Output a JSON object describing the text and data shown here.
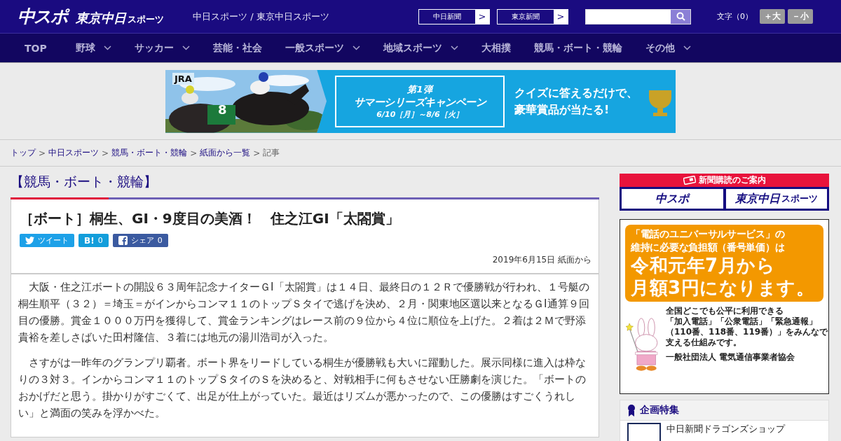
{
  "header": {
    "logo": {
      "main": "中スポ",
      "sub": "東京中日",
      "sub_small": "スポーツ"
    },
    "site_title": "中日スポーツ / 東京中日スポーツ",
    "paper_links": [
      {
        "label": "中日新聞",
        "arrow": ">"
      },
      {
        "label": "東京新聞",
        "arrow": ">"
      }
    ],
    "font_size": {
      "label": "文字（0）",
      "buttons": [
        "＋大",
        "－小"
      ]
    }
  },
  "nav": [
    {
      "label": "TOP",
      "dropdown": false
    },
    {
      "label": "野球",
      "dropdown": true
    },
    {
      "label": "サッカー",
      "dropdown": true
    },
    {
      "label": "芸能・社会",
      "dropdown": false
    },
    {
      "label": "一般スポーツ",
      "dropdown": true
    },
    {
      "label": "地域スポーツ",
      "dropdown": true
    },
    {
      "label": "大相撲",
      "dropdown": false
    },
    {
      "label": "競馬・ボート・競輪",
      "dropdown": false
    },
    {
      "label": "その他",
      "dropdown": true
    }
  ],
  "banner": {
    "brand": "JRA",
    "saddle_number": "8",
    "round": "第1弾",
    "campaign": "サマーシリーズキャンペーン",
    "period": "6/10［月］～8/6［火］",
    "copy": [
      "クイズに答えるだけで、",
      "豪華賞品が当たる!"
    ]
  },
  "breadcrumb": {
    "separator": ">",
    "items": [
      {
        "label": "トップ",
        "link": true
      },
      {
        "label": "中日スポーツ",
        "link": true
      },
      {
        "label": "競馬・ボート・競輪",
        "link": true
      },
      {
        "label": "紙面から一覧",
        "link": true
      },
      {
        "label": "記事",
        "link": false
      }
    ]
  },
  "category": "【競馬・ボート・競輪】",
  "article": {
    "title": "［ボート］桐生、GI・9度目の美酒！　住之江GI「太閤賞」",
    "share": [
      {
        "kind": "twitter",
        "label": "ツイート"
      },
      {
        "kind": "hatena",
        "label": "B!",
        "count": "0"
      },
      {
        "kind": "facebook",
        "label": "シェア",
        "count": "0"
      }
    ],
    "date": "2019年6月15日 紙面から",
    "paragraphs": [
      "　大阪・住之江ボートの開設６３周年記念ナイターＧⅠ「太閤賞」は１４日、最終日の１２Ｒで優勝戦が行われ、１号艇の桐生順平（３２）＝埼玉＝がインからコンマ１１のトップＳタイで逃げを決め、２月・関東地区選以来となるＧⅠ通算９回目の優勝。賞金１０００万円を獲得して、賞金ランキングはレース前の９位から４位に順位を上げた。２着は２Ｍで野添貴裕を差しさばいた田村隆信、３着には地元の湯川浩司が入った。",
      "　さすがは一昨年のグランプリ覇者。ボート界をリードしている桐生が優勝戦も大いに躍動した。展示同様に進入は枠なりの３対３。インからコンマ１１のトップＳタイのＳを決めると、対戦相手に何もさせない圧勝劇を演じた。「ボートのおかげだと思う。掛かりがすごくて、出足が仕上がっていた。最近はリズムが悪かったので、この優勝はすごくうれしい」と満面の笑みを浮かべた。"
    ]
  },
  "sidebar": {
    "subscribe": {
      "heading": "新聞購読のご案内",
      "logos": [
        {
          "main": "中スポ"
        },
        {
          "main": "東京中日",
          "small": "スポーツ"
        }
      ]
    },
    "ad": {
      "bubble": [
        "「電話のユニバーサルサービス」の",
        "維持に必要な負担額（番号単価）は",
        "令和元年7月から",
        "月額3円になります。"
      ],
      "body": [
        "全国どこでも公平に利用できる",
        "「加入電話」「公衆電話」「緊急通報」",
        "（110番、118番、119番）」をみんなで",
        "支える仕組みです。"
      ],
      "sponsor": "一般社団法人 電気通信事業者協会"
    },
    "feature": {
      "title": "企画特集",
      "items": [
        "中日新聞ドラゴンズショップ"
      ]
    }
  }
}
